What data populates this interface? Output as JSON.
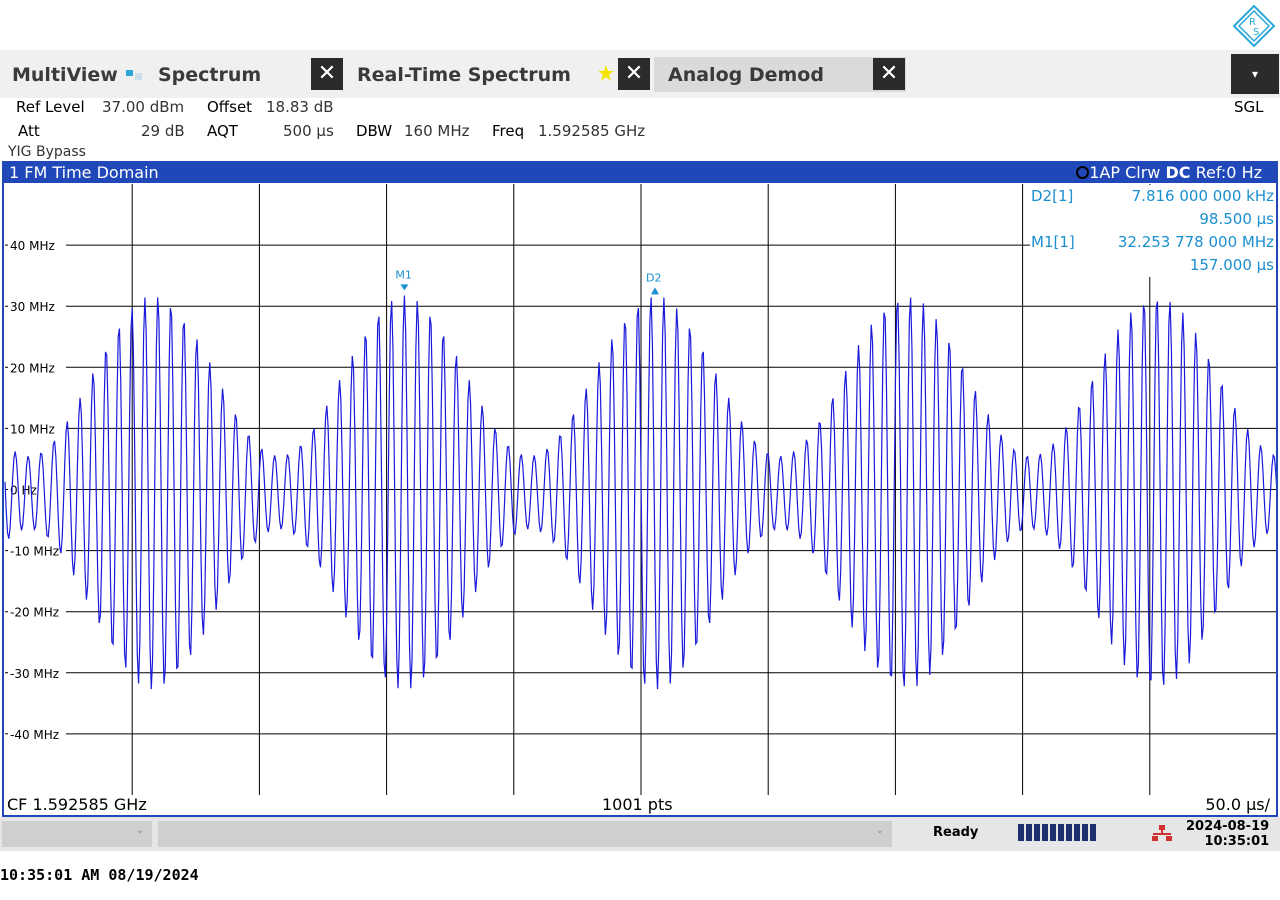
{
  "header": {
    "tabs": [
      {
        "label": "MultiView"
      },
      {
        "label": "Spectrum"
      },
      {
        "label": "Real-Time Spectrum"
      },
      {
        "label": "Analog Demod"
      }
    ],
    "close_glyph": "✕",
    "menu_glyph": "▾",
    "mode": "SGL"
  },
  "params": {
    "ref_level_key": "Ref Level",
    "ref_level_val": "37.00 dBm",
    "offset_key": "Offset",
    "offset_val": "18.83 dB",
    "att_key": "Att",
    "att_val": "29 dB",
    "aqt_key": "AQT",
    "aqt_val": "500 µs",
    "dbw_key": "DBW",
    "dbw_val": "160 MHz",
    "freq_key": "Freq",
    "freq_val": "1.592585 GHz",
    "yig": "YIG Bypass"
  },
  "window": {
    "title": "1 FM Time Domain",
    "trace_info": "1AP Clrw",
    "dc": "DC",
    "ref": "Ref:0 Hz",
    "cf": "CF 1.592585 GHz",
    "pts": "1001 pts",
    "div": "50.0 µs/"
  },
  "markers": {
    "d2_label": "D2[1]",
    "d2_val1": "7.816 000 000 kHz",
    "d2_val2": "98.500 µs",
    "m1_label": "M1[1]",
    "m1_val1": "32.253 778 000 MHz",
    "m1_val2": "157.000 µs",
    "m1_tag": "M1",
    "d2_tag": "D2"
  },
  "chart_data": {
    "type": "line",
    "y_unit": "MHz",
    "y_ticks": [
      "40 MHz",
      "30 MHz",
      "20 MHz",
      "10 MHz",
      "0 Hz",
      "-10 MHz",
      "-20 MHz",
      "-30 MHz",
      "-40 MHz"
    ],
    "ylim": [
      -50,
      50
    ],
    "xlim_us": [
      0,
      500
    ],
    "grid": true,
    "series": [
      {
        "color": "#1a1adb",
        "carrier_period_us": 5.1,
        "envelope_period_us": 98.5,
        "peak_MHz": 32.25,
        "min_MHz": -33
      }
    ],
    "markers": [
      {
        "name": "M1",
        "x_us": 157.0,
        "y_MHz": 32.253778
      },
      {
        "name": "D2",
        "x_us": 255.5,
        "y_MHz": 32.26
      }
    ]
  },
  "status": {
    "state": "Ready",
    "date": "2024-08-19",
    "time": "10:35:01",
    "progress_fraction": 1.0
  },
  "footer_timestamp": "10:35:01 AM  08/19/2024",
  "colors": {
    "accent": "#2048b8",
    "trace": "#1a1adb",
    "marker": "#1a8fd0"
  }
}
